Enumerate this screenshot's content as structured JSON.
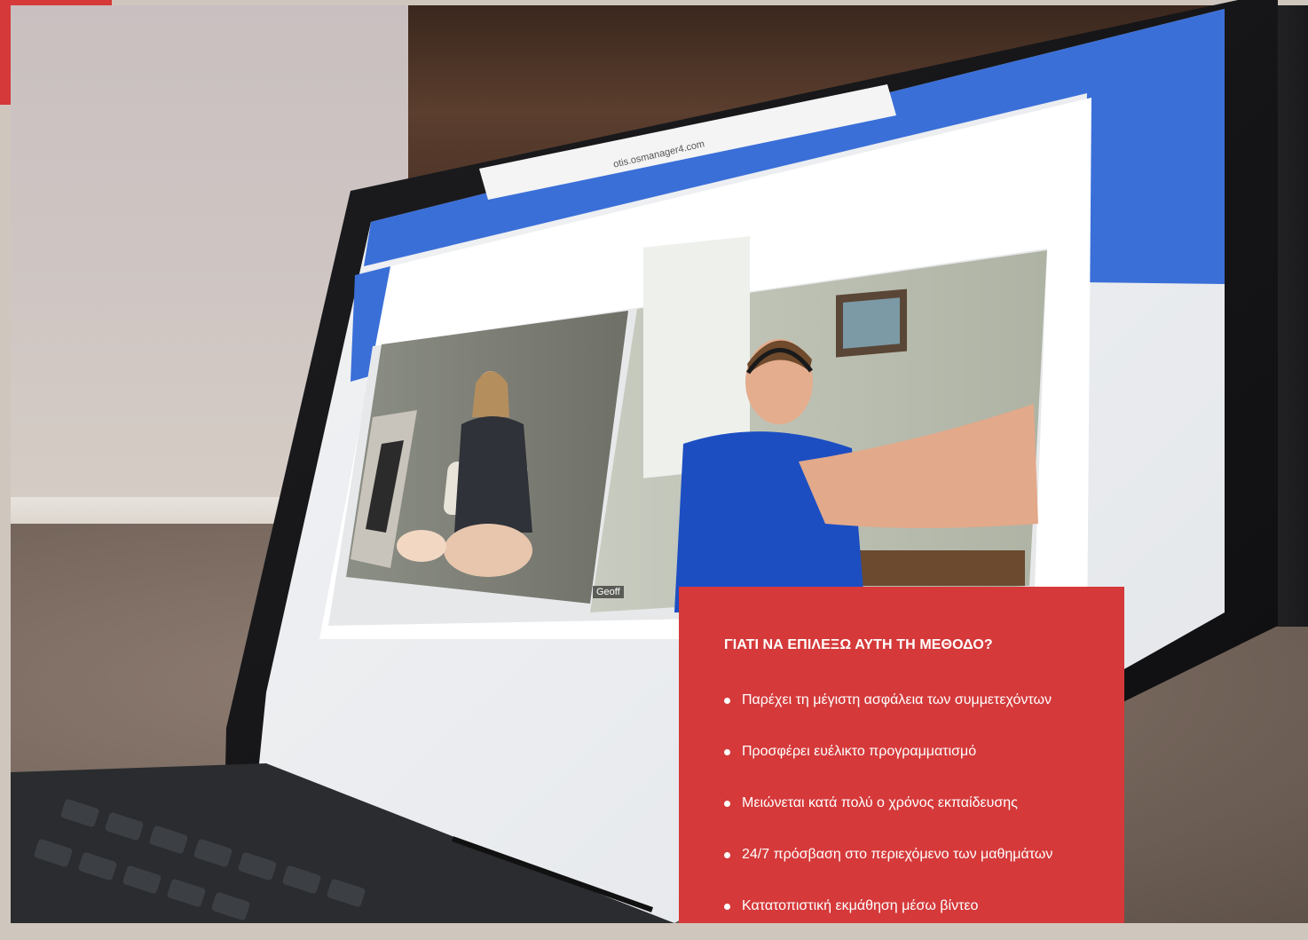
{
  "photo": {
    "address_bar": "otis.osmanager4.com",
    "participant_label": "Geoff"
  },
  "info_panel": {
    "title": "ΓΙΑΤΙ ΝΑ ΕΠΙΛΕΞΩ ΑΥΤΗ ΤΗ ΜΕΘΟΔΟ?",
    "items": [
      "Παρέχει τη μέγιστη ασφάλεια των συμμετεχόντων",
      "Προσφέρει ευέλικτο προγραμματισμό",
      "Μειώνεται κατά πολύ ο χρόνος εκπαίδευσης",
      "24/7 πρόσβαση στο περιεχόμενο των μαθημάτων",
      "Κατατοπιστική εκμάθηση μέσω βίντεο"
    ]
  },
  "colors": {
    "accent_red": "#d5393a",
    "panel_text": "#ffffff"
  }
}
